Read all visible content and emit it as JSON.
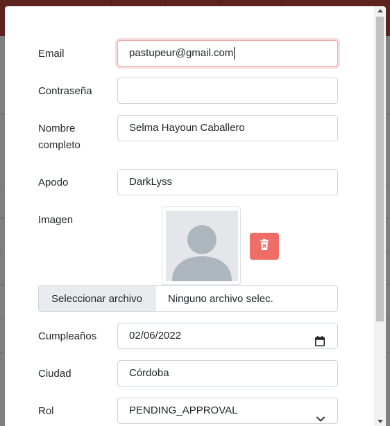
{
  "form": {
    "email": {
      "label": "Email",
      "value": "pastupeur@gmail.com"
    },
    "password": {
      "label": "Contraseña",
      "value": ""
    },
    "full_name": {
      "label_line1": "Nombre",
      "label_line2": "completo",
      "value": "Selma Hayoun Caballero"
    },
    "nickname": {
      "label": "Apodo",
      "value": "DarkLyss"
    },
    "image": {
      "label": "Imagen",
      "avatar_icon": "user-placeholder-icon",
      "delete_icon": "trash-x-icon"
    },
    "file": {
      "button_label": "Seleccionar archivo",
      "file_name": "Ninguno archivo selec."
    },
    "birthday": {
      "label": "Cumpleaños",
      "value": "02/06/2022",
      "icon": "calendar-icon"
    },
    "city": {
      "label": "Ciudad",
      "value": "Córdoba"
    },
    "role": {
      "label": "Rol",
      "value": "PENDING_APPROVAL",
      "icon": "chevron-down-icon"
    }
  },
  "colors": {
    "header": "#b8473f",
    "delete_button": "#ee6d67",
    "focus_border": "#f1a9a6"
  }
}
